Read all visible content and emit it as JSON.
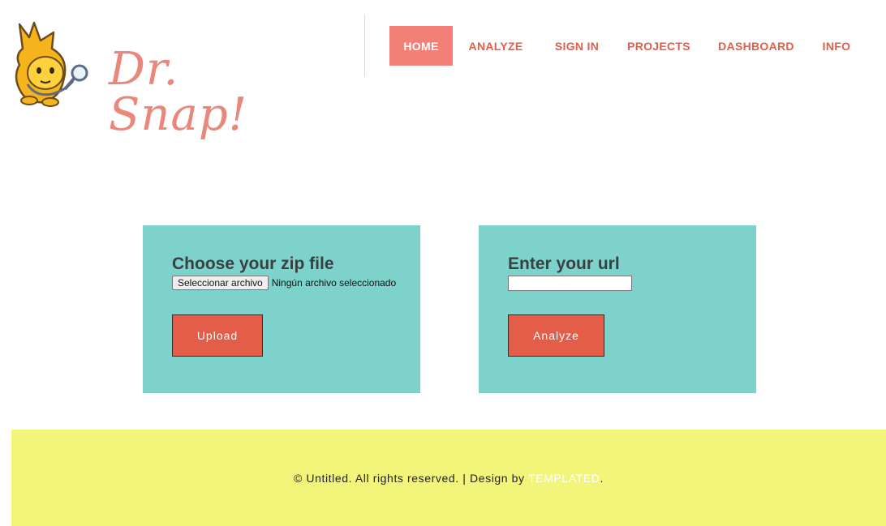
{
  "brand": {
    "name": "Dr. Snap!",
    "logo_icon": "snap-cat-detective-icon"
  },
  "nav": {
    "items": [
      {
        "label": "HOME",
        "active": true
      },
      {
        "label": "ANALYZE"
      },
      {
        "label": "SIGN IN"
      },
      {
        "label": "PROJECTS"
      },
      {
        "label": "DASHBOARD"
      },
      {
        "label": "INFO"
      }
    ]
  },
  "upload_card": {
    "title": "Choose your zip file",
    "file_button": "Seleccionar archivo",
    "file_status": "Ningún archivo seleccionado",
    "submit": "Upload"
  },
  "url_card": {
    "title": "Enter your url",
    "input_value": "",
    "submit": "Analyze"
  },
  "footer": {
    "text": "© Untitled. All rights reserved. | Design by ",
    "link": "TEMPLATED",
    "suffix": "."
  },
  "colors": {
    "accent": "#e35d48",
    "nav_active_bg": "#f47f77",
    "card_bg": "#7dd3cc",
    "footer_bg": "#f2f57a",
    "logo_text": "#e8877a"
  }
}
